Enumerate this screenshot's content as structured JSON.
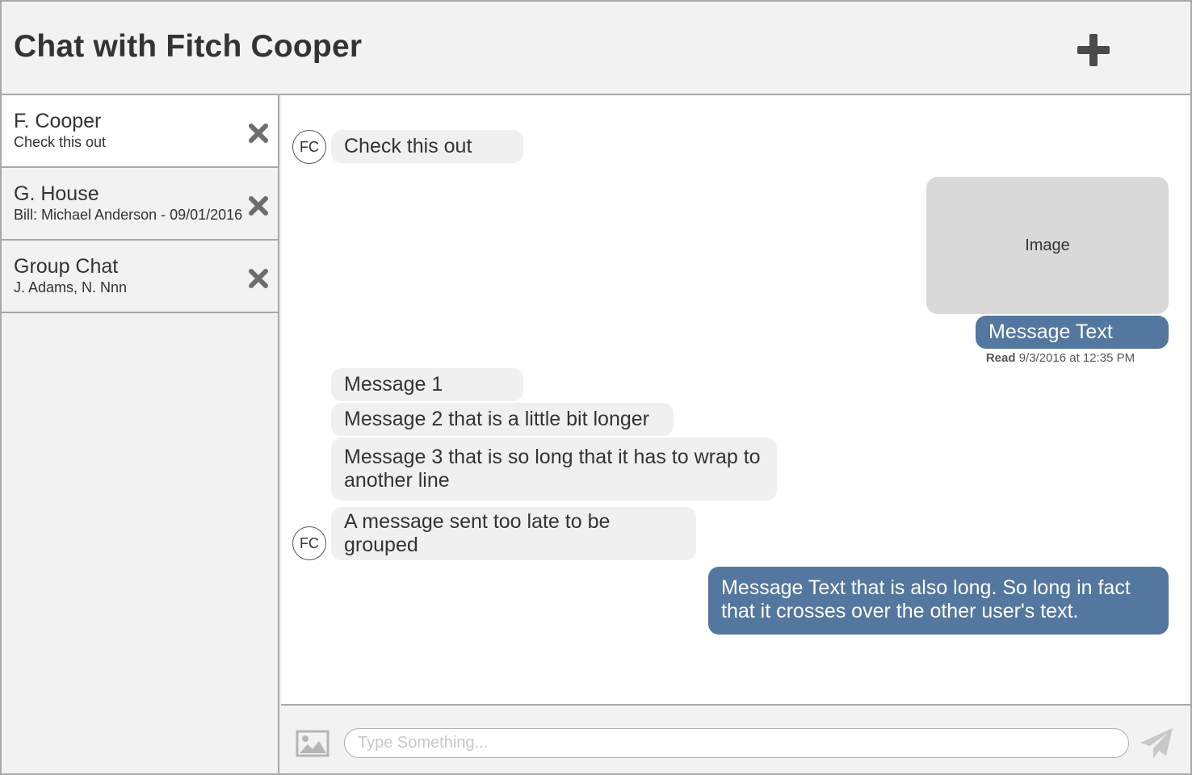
{
  "header": {
    "title": "Chat with Fitch Cooper",
    "add_icon": "plus-icon"
  },
  "sidebar": {
    "conversations": [
      {
        "name": "F. Cooper",
        "preview": "Check this out",
        "active": true,
        "close_icon": "close-x-icon"
      },
      {
        "name": "G. House",
        "preview": "Bill: Michael Anderson - 09/01/2016",
        "active": false,
        "close_icon": "close-x-icon"
      },
      {
        "name": "Group Chat",
        "preview": "J. Adams, N. Nnn",
        "active": false,
        "close_icon": "close-x-icon"
      }
    ]
  },
  "chat": {
    "avatar_initials": "FC",
    "messages": [
      {
        "direction": "incoming",
        "text": "Check this out",
        "avatar": "FC"
      },
      {
        "direction": "outgoing",
        "image_label": "Image"
      },
      {
        "direction": "outgoing",
        "text": "Message Text"
      },
      {
        "direction": "incoming",
        "text": "Message 1"
      },
      {
        "direction": "incoming",
        "text": "Message 2 that is a little bit longer"
      },
      {
        "direction": "incoming",
        "text": "Message 3 that is so long that it has to wrap to another line"
      },
      {
        "direction": "incoming",
        "text": "A message sent too late to be grouped",
        "avatar": "FC"
      },
      {
        "direction": "outgoing",
        "text": "Message Text that is also long. So long in fact that it crosses over the other user's text."
      }
    ],
    "receipt": {
      "label": "Read",
      "timestamp": "9/3/2016 at 12:35 PM"
    }
  },
  "composer": {
    "placeholder": "Type Something...",
    "value": "",
    "image_icon": "image-icon",
    "send_icon": "send-icon"
  },
  "colors": {
    "outgoing_bubble": "#53779e",
    "incoming_bubble": "#f0f0f0",
    "panel_background": "#f2f2f2",
    "border": "#a8a8a8"
  }
}
